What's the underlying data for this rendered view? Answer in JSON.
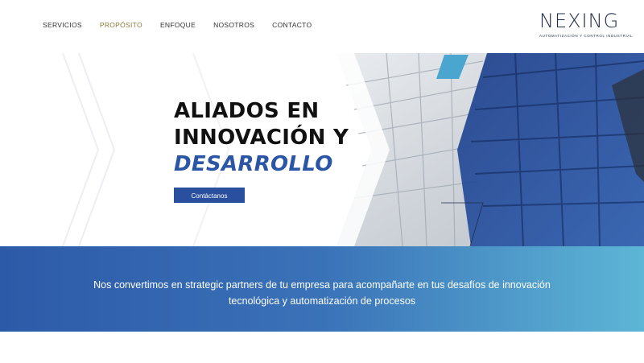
{
  "nav": {
    "items": [
      {
        "label": "SERVICIOS"
      },
      {
        "label": "PROPÓSITO"
      },
      {
        "label": "ENFOQUE"
      },
      {
        "label": "NOSOTROS"
      },
      {
        "label": "CONTACTO"
      }
    ],
    "active_color": "#8a7a3c"
  },
  "logo": {
    "wordmark": "NEXING",
    "tagline": "AUTOMATIZACIÓN Y CONTROL INDUSTRIAL"
  },
  "hero": {
    "line1": "ALIADOS EN",
    "line2": "INNOVACIÓN Y",
    "line3": "DESARROLLO",
    "cta_label": "Contáctanos"
  },
  "band": {
    "text": "Nos convertimos en strategic partners de tu empresa para acompañarte en tus desafíos de innovación tecnológica y automatización de procesos"
  },
  "colors": {
    "brand_blue": "#2a4f9e",
    "accent_cyan": "#5db6d6",
    "dark_navy": "#1f2d4a"
  }
}
